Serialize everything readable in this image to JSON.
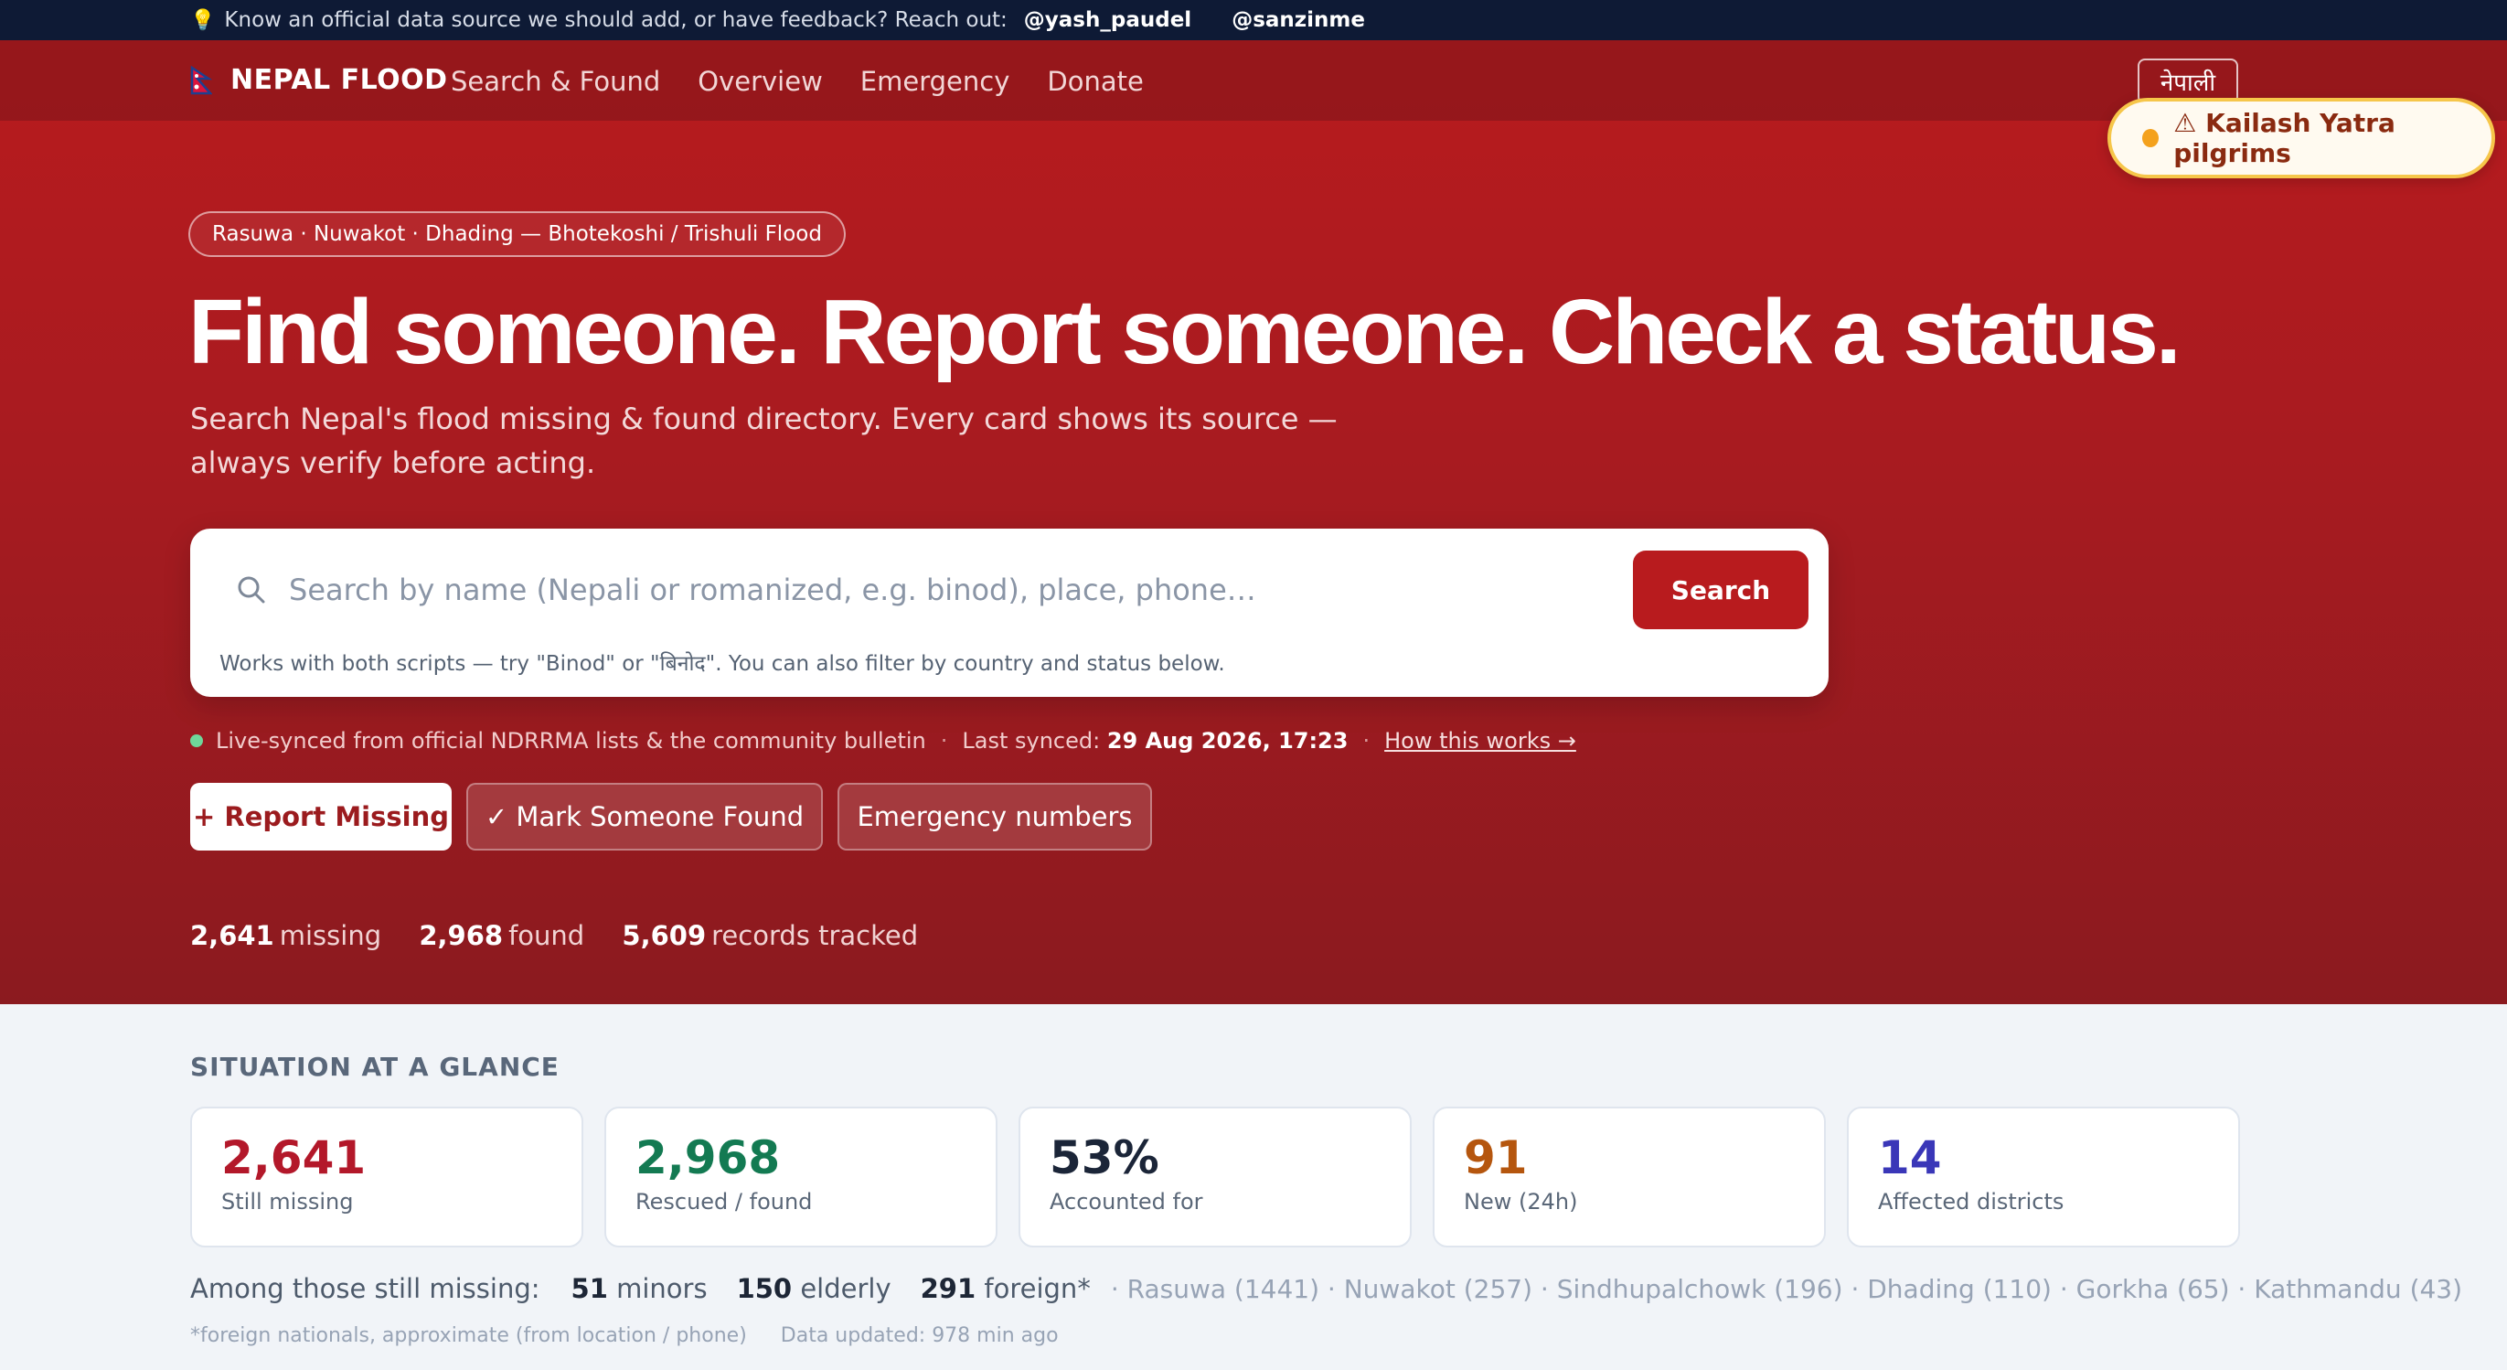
{
  "topbar": {
    "message": "Know an official data source we should add, or have feedback? Reach out:",
    "handle1": "@yash_paudel",
    "handle2": "@sanzinme"
  },
  "nav": {
    "brand": "NEPAL FLOOD",
    "links": [
      "Search & Found",
      "Overview",
      "Emergency",
      "Donate"
    ],
    "language": "नेपाली"
  },
  "alert": {
    "text": "⚠ Kailash Yatra pilgrims",
    "color": "#f4a11c"
  },
  "hero": {
    "badge": "Rasuwa · Nuwakot · Dhading — Bhotekoshi / Trishuli Flood",
    "headline": "Find someone. Report someone. Check a status.",
    "subhead": "Search Nepal's flood missing & found directory. Every card shows its source — always verify before acting."
  },
  "search": {
    "placeholder": "Search by name (Nepali or romanized, e.g. binod), place, phone…",
    "button": "Search",
    "hint": "Works with both scripts — try \"Binod\" or \"बिनोद\". You can also filter by country and status below."
  },
  "sync": {
    "source": "Live-synced from official NDRRMA lists & the community bulletin",
    "last_synced_label": "Last synced:",
    "last_synced_value": "29 Aug 2026, 17:23",
    "how_link": "How this works →"
  },
  "actions": {
    "report": "+ Report Missing",
    "found": "✓ Mark Someone Found",
    "emergency": "Emergency numbers"
  },
  "counts": {
    "missing_num": "2,641",
    "missing_lbl": "missing",
    "found_num": "2,968",
    "found_lbl": "found",
    "records_num": "5,609",
    "records_lbl": "records tracked"
  },
  "situation": {
    "title": "SITUATION AT A GLANCE",
    "stats": [
      {
        "value": "2,641",
        "label": "Still missing",
        "color": "#b3182a"
      },
      {
        "value": "2,968",
        "label": "Rescued / found",
        "color": "#137a52"
      },
      {
        "value": "53%",
        "label": "Accounted for",
        "color": "#1b2538"
      },
      {
        "value": "91",
        "label": "New (24h)",
        "color": "#b5560e"
      },
      {
        "value": "14",
        "label": "Affected districts",
        "color": "#3a37b8"
      }
    ],
    "among_label": "Among those still missing:",
    "minors_num": "51",
    "minors_lbl": "minors",
    "elderly_num": "150",
    "elderly_lbl": "elderly",
    "foreign_num": "291",
    "foreign_lbl": "foreign*",
    "districts": "· Rasuwa (1441) · Nuwakot (257) · Sindhupalchowk (196) · Dhading (110) · Gorkha (65) · Kathmandu (43)",
    "footnote": "*foreign nationals, approximate (from location / phone)",
    "updated": "Data updated: 978 min ago"
  }
}
